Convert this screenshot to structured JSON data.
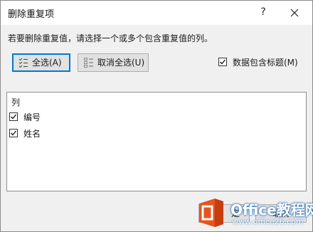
{
  "dialog": {
    "title": "删除重复项",
    "help_label": "?",
    "instruction": "若要删除重复值，请选择一个或多个包含重复值的列。",
    "select_all_label": "全选(A)",
    "unselect_all_label": "取消全选(U)",
    "header_checkbox": {
      "label": "数据包含标题(M)",
      "checked": true
    },
    "list": {
      "column_header": "列",
      "items": [
        {
          "label": "编号",
          "checked": true
        },
        {
          "label": "姓名",
          "checked": true
        }
      ]
    },
    "ok_label": "定",
    "cancel_label": "取消"
  },
  "watermark": {
    "title": "Office教程网",
    "url": "www.office26.com",
    "brand_color": "#e8541c"
  }
}
